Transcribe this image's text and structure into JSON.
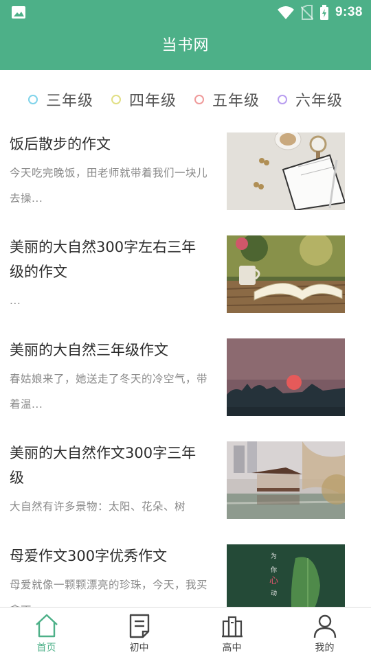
{
  "status_bar": {
    "time": "9:38",
    "icons": [
      "image-icon",
      "wifi-icon",
      "no-sim-icon",
      "battery-charging-icon"
    ]
  },
  "app_bar": {
    "title": "当书网"
  },
  "grades": [
    {
      "label": "三年级",
      "color": "#7fd3ea"
    },
    {
      "label": "四年级",
      "color": "#e1df84"
    },
    {
      "label": "五年级",
      "color": "#ef9a9a"
    },
    {
      "label": "六年级",
      "color": "#b89df0"
    }
  ],
  "articles": [
    {
      "title": "饭后散步的作文",
      "summary": "今天吃完晚饭，田老师就带着我们一块儿去操..."
    },
    {
      "title": "美丽的大自然300字左右三年级的作文",
      "summary": "..."
    },
    {
      "title": "美丽的大自然三年级作文",
      "summary": "春姑娘来了，她送走了冬天的冷空气，带着温..."
    },
    {
      "title": "美丽的大自然作文300字三年级",
      "summary": "大自然有许多景物：太阳、花朵、树"
    },
    {
      "title": "母爱作文300字优秀作文",
      "summary": "母爱就像一颗颗漂亮的珍珠，今天，我买拿丁"
    }
  ],
  "tabs": [
    {
      "label": "首页",
      "icon": "home-icon",
      "active": true
    },
    {
      "label": "初中",
      "icon": "document-icon",
      "active": false
    },
    {
      "label": "高中",
      "icon": "books-icon",
      "active": false
    },
    {
      "label": "我的",
      "icon": "person-icon",
      "active": false
    }
  ],
  "colors": {
    "primary": "#4db088",
    "text": "#2c2c2c",
    "muted": "#8a8a8a"
  }
}
